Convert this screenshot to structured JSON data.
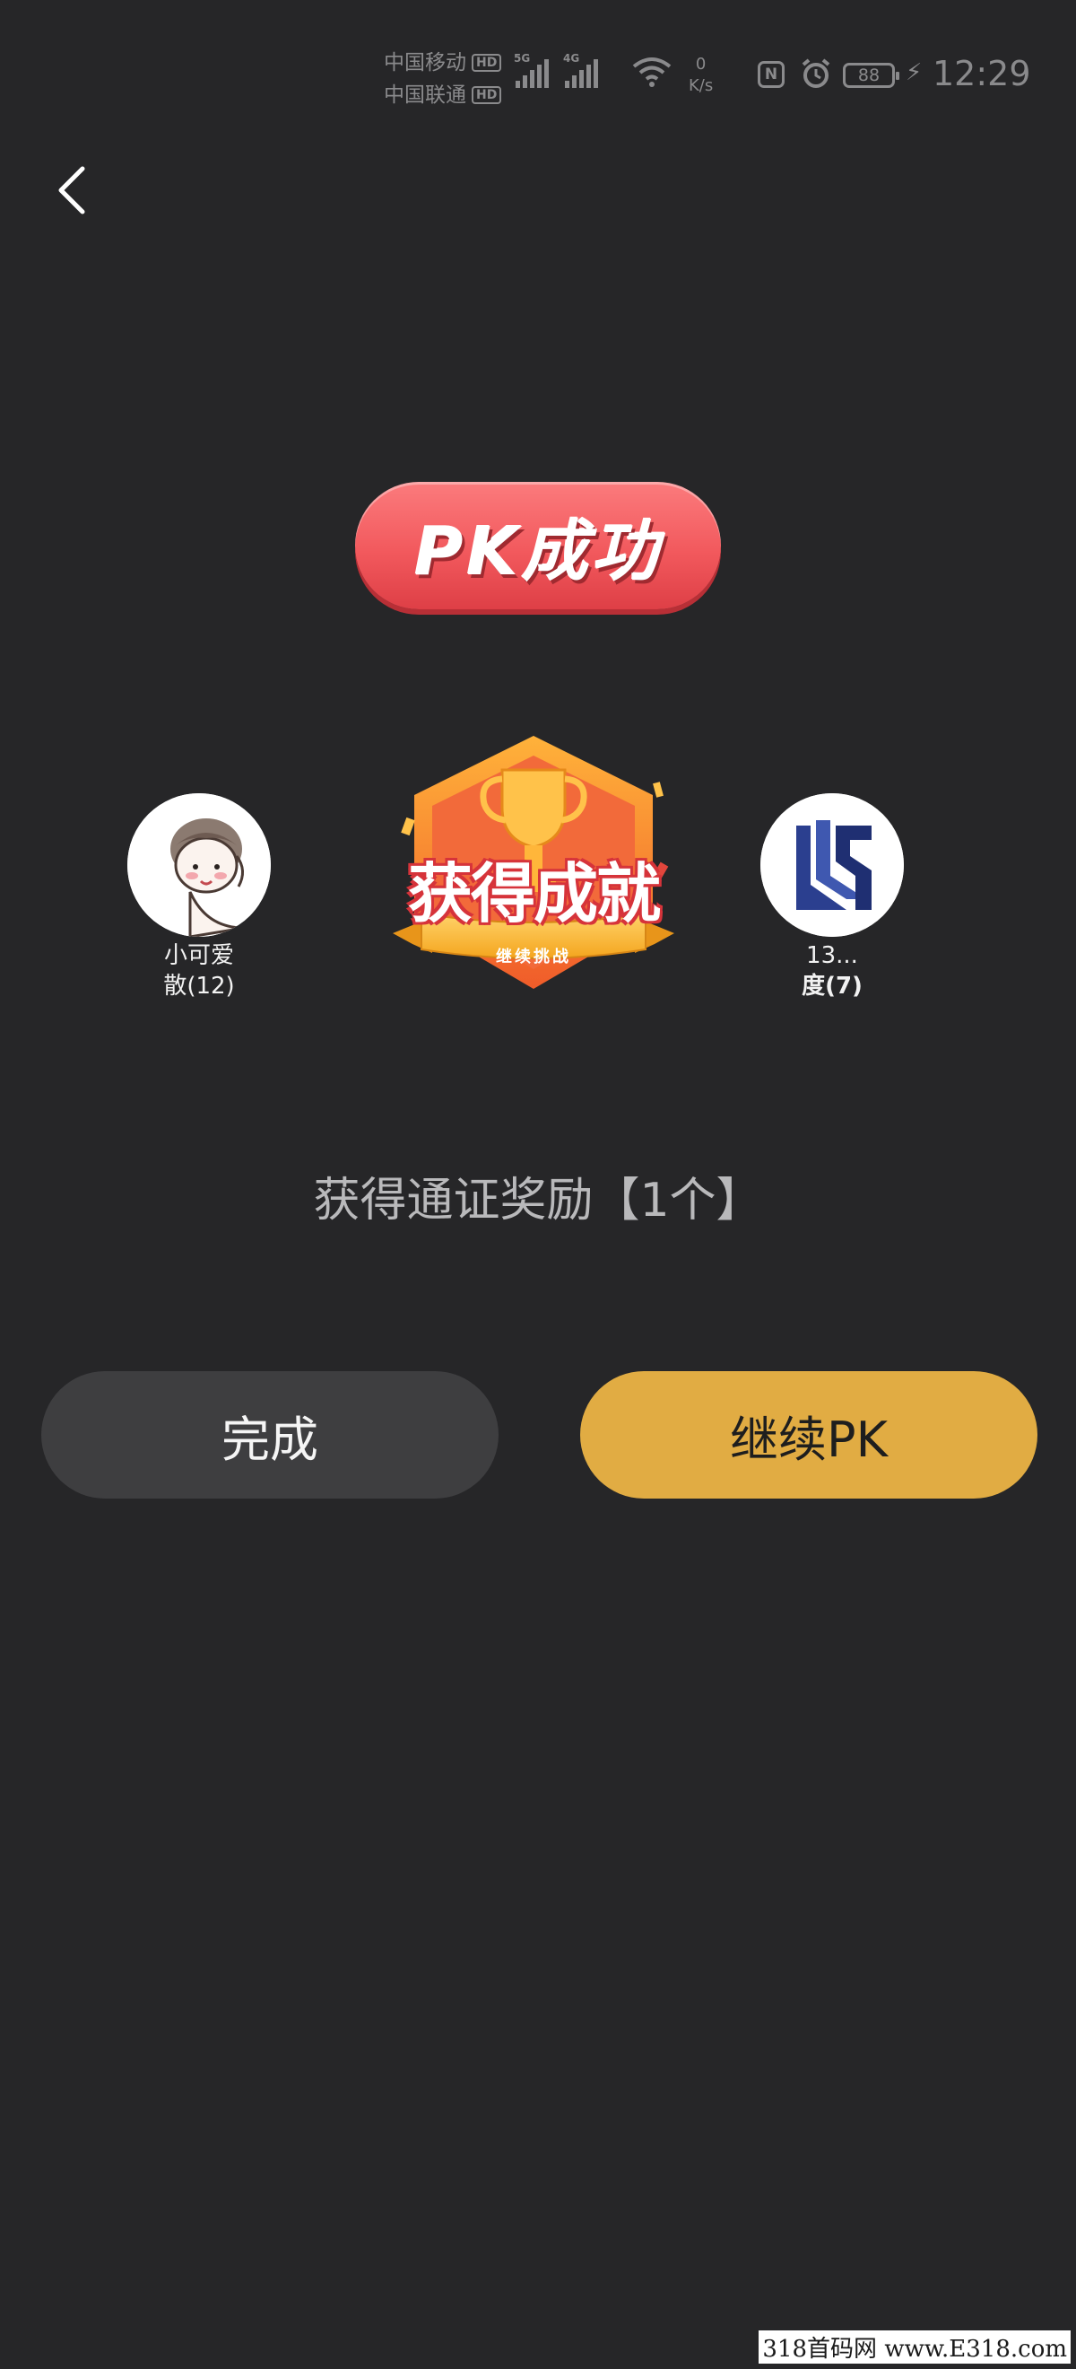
{
  "status_bar": {
    "carrier_1": "中国移动",
    "carrier_2": "中国联通",
    "hd_tag": "HD",
    "sim1_generation": "5G",
    "sim2_generation": "4G",
    "net_speed_value": "0",
    "net_speed_unit": "K/s",
    "nfc_label": "N",
    "battery_level": "88",
    "time": "12:29"
  },
  "header": {
    "back_icon": "chevron-left-icon"
  },
  "result": {
    "badge_text": "PK成功"
  },
  "players": {
    "left": {
      "name": "小可爱",
      "score": "散(12)"
    },
    "right": {
      "name": "13...",
      "score": "度(7)"
    }
  },
  "achievement": {
    "title": "获得成就",
    "ribbon_text": "继续挑战"
  },
  "reward": {
    "text": "获得通证奖励【1个】"
  },
  "buttons": {
    "done_label": "完成",
    "continue_label": "继续PK"
  },
  "watermark": "318首码网 www.E318.com",
  "colors": {
    "background": "#262628",
    "accent": "#e1ac43",
    "badge_red": "#f2595d",
    "secondary_button": "#3e3e40"
  }
}
